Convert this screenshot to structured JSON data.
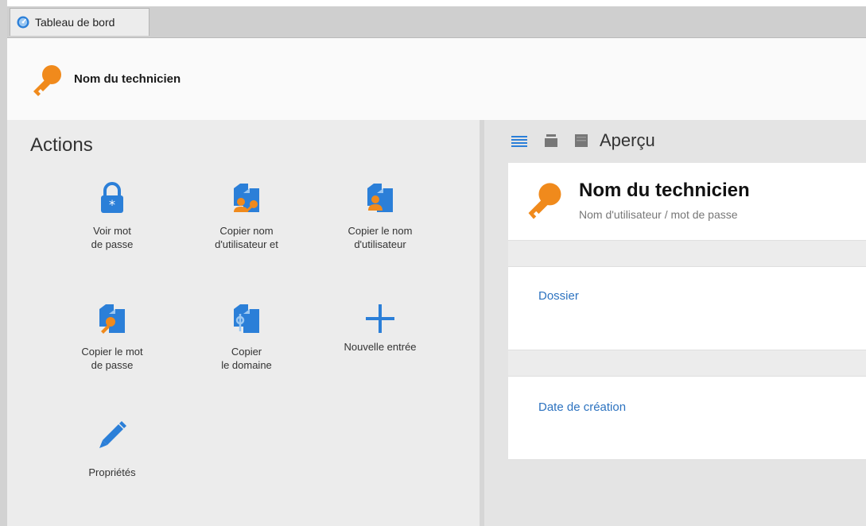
{
  "tab": {
    "label": "Tableau de bord",
    "icon": "dashboard-icon"
  },
  "header": {
    "title": "Nom du technicien",
    "icon": "key-icon"
  },
  "actions": {
    "title": "Actions",
    "items": [
      {
        "label": "Voir mot\nde passe",
        "icon": "lock-icon"
      },
      {
        "label": "Copier nom\nd'utilisateur et",
        "icon": "copy-user-password-icon"
      },
      {
        "label": "Copier le nom\nd'utilisateur",
        "icon": "copy-user-icon"
      },
      {
        "label": "Copier le mot\nde passe",
        "icon": "copy-password-icon"
      },
      {
        "label": "Copier\nle domaine",
        "icon": "copy-domain-icon"
      },
      {
        "label": "Nouvelle entrée",
        "icon": "plus-icon"
      },
      {
        "label": "Propriétés",
        "icon": "pencil-icon"
      }
    ]
  },
  "preview": {
    "title": "Aperçu",
    "entry_title": "Nom du technicien",
    "entry_subtitle": "Nom d'utilisateur / mot de passe",
    "fields": [
      {
        "label": "Dossier"
      },
      {
        "label": "Date de création"
      }
    ]
  },
  "colors": {
    "accent": "#2b7fd8",
    "key": "#f08a1c",
    "link": "#2d73c0"
  }
}
